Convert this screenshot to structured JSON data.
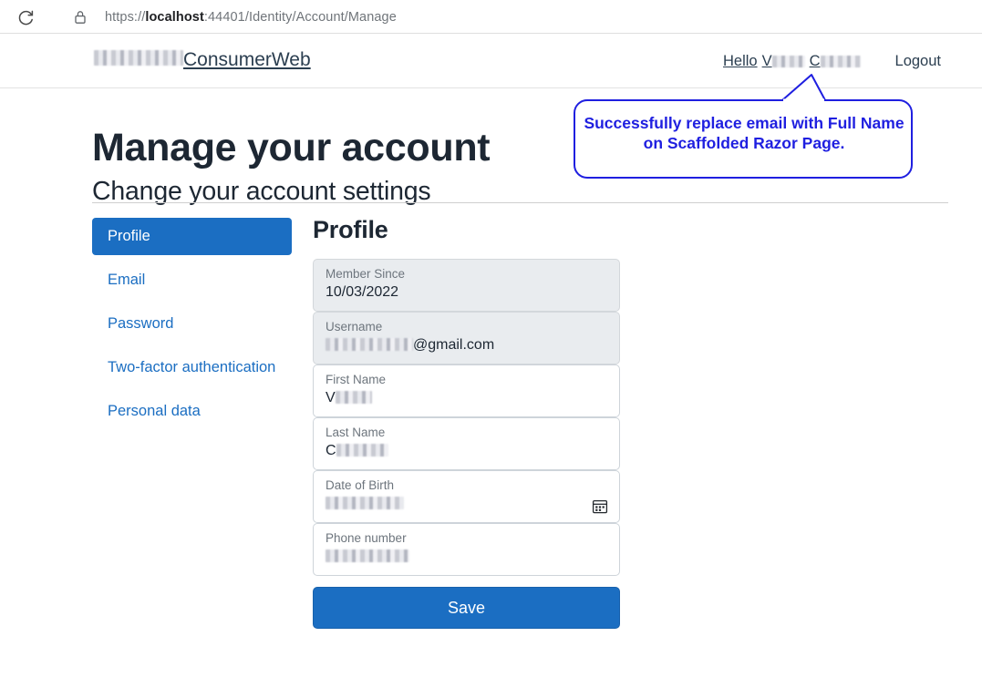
{
  "browser": {
    "reload_icon": "reload-icon",
    "lock_icon": "lock-icon",
    "url_scheme": "https://",
    "url_host": "localhost",
    "url_path": ":44401/Identity/Account/Manage",
    "url_full": "https://localhost:44401/Identity/Account/Manage"
  },
  "navbar": {
    "brand_redacted": "[redacted]",
    "brand_name": "ConsumerWeb",
    "greeting_prefix": "Hello",
    "greeting_first_initial": "V",
    "greeting_last_initial": "C",
    "logout_label": "Logout"
  },
  "callout": {
    "text": "Successfully replace email with Full Name on Scaffolded Razor Page.",
    "border_color": "#1f1fe0",
    "text_color": "#1f1fe0"
  },
  "page": {
    "title": "Manage your account",
    "subtitle": "Change your account settings"
  },
  "sidebar": {
    "items": [
      {
        "label": "Profile",
        "active": true
      },
      {
        "label": "Email",
        "active": false
      },
      {
        "label": "Password",
        "active": false
      },
      {
        "label": "Two-factor authentication",
        "active": false
      },
      {
        "label": "Personal data",
        "active": false
      }
    ]
  },
  "profile": {
    "heading": "Profile",
    "fields": [
      {
        "label": "Member Since",
        "value": "10/03/2022",
        "disabled": true,
        "redacted": false
      },
      {
        "label": "Username",
        "value": "@gmail.com",
        "disabled": true,
        "redacted": true,
        "redact_class": "w-user",
        "redact_before": true
      },
      {
        "label": "First Name",
        "value": "V",
        "disabled": false,
        "redacted": true,
        "redact_class": "w-first",
        "redact_before": false
      },
      {
        "label": "Last Name",
        "value": "C",
        "disabled": false,
        "redacted": true,
        "redact_class": "w-last",
        "redact_before": false
      },
      {
        "label": "Date of Birth",
        "value": "",
        "disabled": false,
        "redacted": true,
        "redact_class": "w-dob",
        "redact_before": false,
        "has_calendar": true
      },
      {
        "label": "Phone number",
        "value": "",
        "disabled": false,
        "redacted": true,
        "redact_class": "w-phone",
        "redact_before": false
      }
    ],
    "save_label": "Save"
  },
  "colors": {
    "primary": "#1b6ec2",
    "disabled_field_bg": "#e9ecef",
    "annotation": "#1f1fe0"
  }
}
